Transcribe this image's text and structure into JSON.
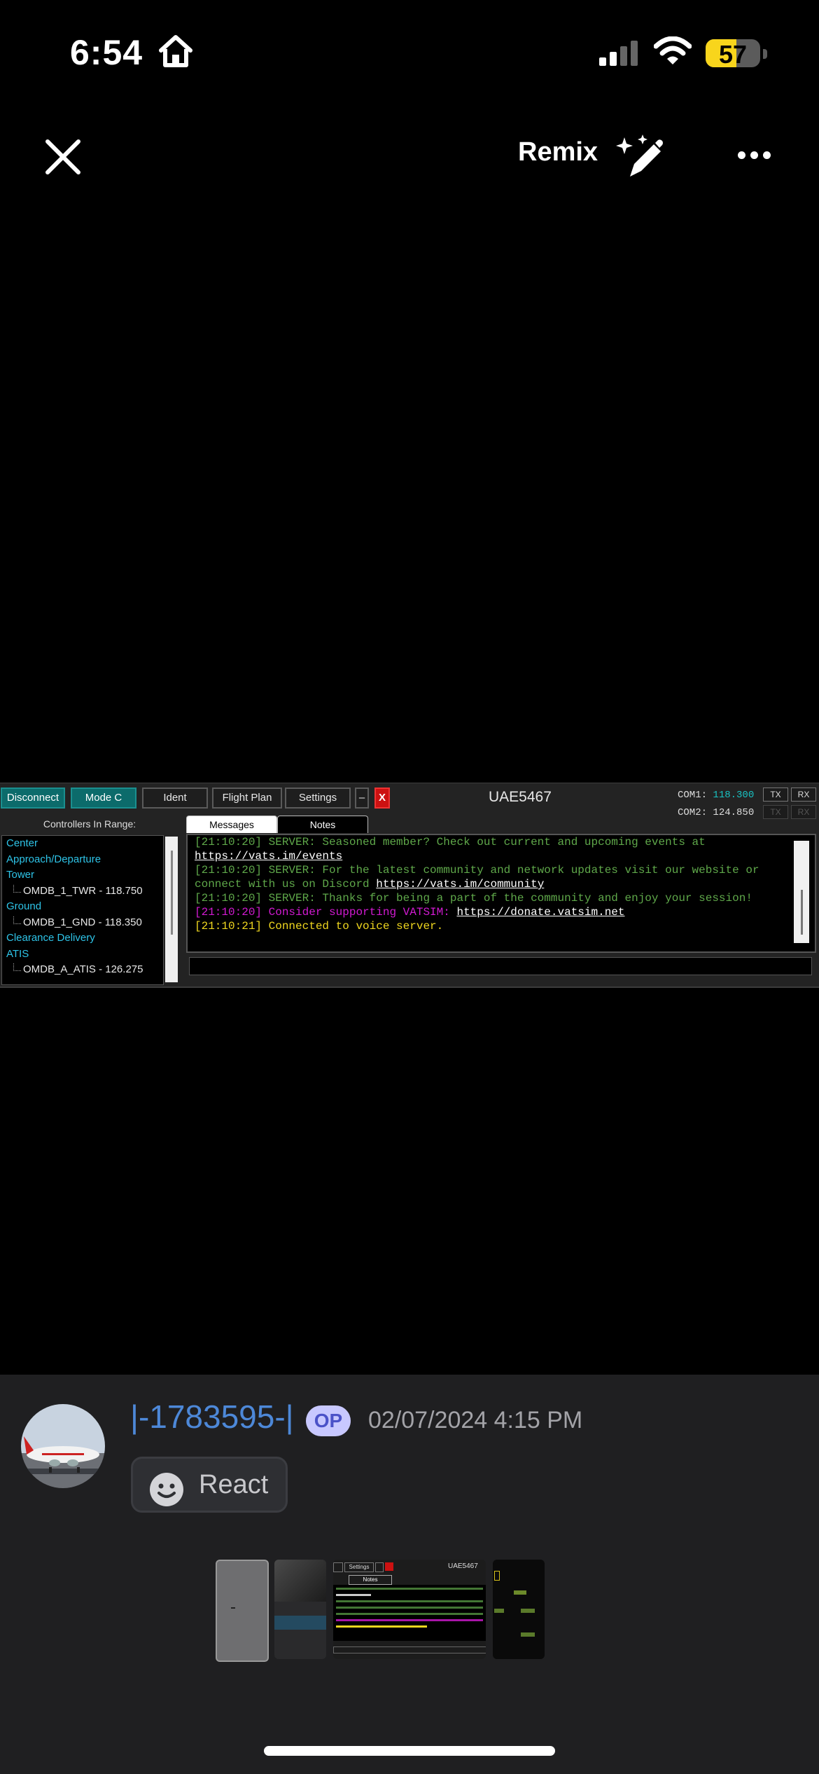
{
  "status_bar": {
    "time": "6:54",
    "battery_level": "57"
  },
  "toolbar": {
    "remix_label": "Remix"
  },
  "vpilot": {
    "buttons": {
      "disconnect": "Disconnect",
      "mode_c": "Mode C",
      "ident": "Ident",
      "flight_plan": "Flight Plan",
      "settings": "Settings",
      "minimize": "–",
      "close": "X"
    },
    "callsign": "UAE5467",
    "com1_label": "COM1:",
    "com1_freq": "118.300",
    "com2_label": "COM2:",
    "com2_freq": "124.850",
    "tx_label": "TX",
    "rx_label": "RX",
    "controllers_label": "Controllers In Range:",
    "controllers": {
      "center": "Center",
      "approach": "Approach/Departure",
      "tower": "Tower",
      "tower_station": "OMDB_1_TWR - 118.750",
      "ground": "Ground",
      "ground_station": "OMDB_1_GND - 118.350",
      "clearance": "Clearance Delivery",
      "atis": "ATIS",
      "atis_station": "OMDB_A_ATIS - 126.275"
    },
    "tabs": {
      "messages": "Messages",
      "notes": "Notes"
    },
    "messages": {
      "m1_text": "[21:10:20] SERVER: Seasoned member? Check out current and upcoming events at",
      "m1_link": "https://vats.im/events",
      "m2_text": "[21:10:20] SERVER: For the latest community and network updates visit our website or connect with us on Discord ",
      "m2_link": "https://vats.im/community",
      "m3_text": "[21:10:20] SERVER: Thanks for being a part of the community and enjoy your session!",
      "m4_text": "[21:10:20] Consider supporting VATSIM: ",
      "m4_link": "https://donate.vatsim.net",
      "m5_text": "[21:10:21] Connected to voice server."
    }
  },
  "post": {
    "username": "|-1783595-|",
    "op_badge": "OP",
    "date": "02/07/2024 4:15 PM",
    "react_label": "React"
  },
  "thumbnail_strip": {
    "callsign": "UAE5467",
    "settings": "Settings",
    "notes": "Notes"
  },
  "colors": {
    "accent_teal": "#0c6b6b",
    "username_blue": "#4d88d8",
    "server_green": "#5fa84a",
    "support_pink": "#d21ad2",
    "voice_yellow": "#f0d71f"
  }
}
